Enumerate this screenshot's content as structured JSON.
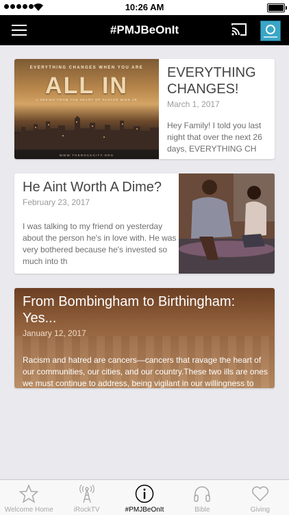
{
  "status": {
    "time": "10:26 AM"
  },
  "nav": {
    "title": "#PMJBeOnIt"
  },
  "posts": [
    {
      "title": "EVERYTHING CHANGES!",
      "date": "March 1, 2017",
      "excerpt": "Hey Family! I told you last night that over the next 26 days, EVERYTHING CH",
      "image": {
        "tagline": "EVERYTHING CHANGES WHEN YOU ARE",
        "headline": "ALL IN",
        "subtitle": "A SERIES FROM THE HEART OF PASTOR MIKE JR",
        "footer": "WWW.THEROCKCITY.ORG"
      }
    },
    {
      "title": "He Aint Worth A Dime?",
      "date": "February 23, 2017",
      "excerpt": "I was talking to my friend on yesterday about the person he's in love with. He was very bothered because he's invested so much into th"
    },
    {
      "title": "From Bombingham to Birthingham: Yes...",
      "date": "January 12, 2017",
      "excerpt": "Racism and hatred are cancers—cancers that ravage the heart of our communities, our cities, and our country.These two ills are ones we must continue to address, being vigilant in our willingness to confront them wherever they exist.However, two"
    }
  ],
  "tabs": [
    {
      "label": "Welcome Home",
      "icon": "star-icon"
    },
    {
      "label": "iRockTV",
      "icon": "broadcast-tower-icon"
    },
    {
      "label": "#PMJBeOnIt",
      "icon": "info-icon",
      "active": true
    },
    {
      "label": "Bible",
      "icon": "headphones-icon"
    },
    {
      "label": "Giving",
      "icon": "heart-icon"
    }
  ]
}
